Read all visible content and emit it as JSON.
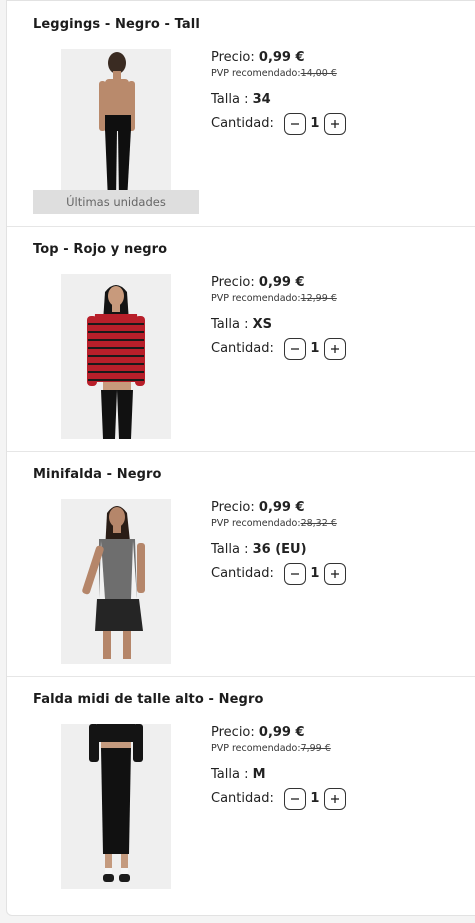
{
  "labels": {
    "price": "Precio:",
    "rrp": "PVP recomendado:",
    "size": "Talla :",
    "quantity": "Cantidad:"
  },
  "items": [
    {
      "title": "Leggings - Negro - Tall",
      "price": "0,99 €",
      "rrp": "14,00 €",
      "size": "34",
      "quantity": "1",
      "badge": "Últimas unidades"
    },
    {
      "title": "Top - Rojo y negro",
      "price": "0,99 €",
      "rrp": "12,99 €",
      "size": "XS",
      "quantity": "1"
    },
    {
      "title": "Minifalda - Negro",
      "price": "0,99 €",
      "rrp": "28,32 €",
      "size": "36 (EU)",
      "quantity": "1"
    },
    {
      "title": "Falda midi de talle alto - Negro",
      "price": "0,99 €",
      "rrp": "7,99 €",
      "size": "M",
      "quantity": "1"
    }
  ],
  "icons": {
    "decrease": "minus-icon",
    "increase": "plus-icon"
  }
}
